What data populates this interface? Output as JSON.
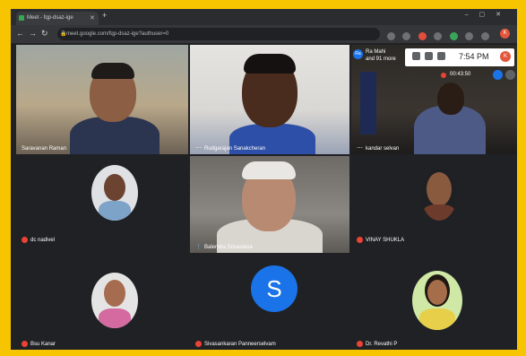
{
  "browser": {
    "tab_title": "Meet - fqp-dsaz-ige",
    "url": "meet.google.com/fqp-dsaz-ige?authuser=0",
    "profile_initial": "K"
  },
  "meeting": {
    "participants_label_line1": "Ra Mahi",
    "participants_label_line2": "and 91 more",
    "clock": "7:54 PM",
    "user_initial": "K",
    "elapsed": "00:43:50"
  },
  "tiles": [
    {
      "name": "Saravanan Raman"
    },
    {
      "name": "Rudgarajan Sanakcheran"
    },
    {
      "name": "kandar selvan"
    },
    {
      "name": "dc nadivel"
    },
    {
      "name": "Balendra Srivastava"
    },
    {
      "name": "VINAY SHUKLA"
    },
    {
      "name": "Bsu Kanar"
    },
    {
      "name": "Sivasankaran Panneerselvam",
      "avatar_letter": "S"
    },
    {
      "name": "Dr. Revathi P"
    }
  ],
  "colors": {
    "frame": "#f7c500",
    "meet_bg": "#202124",
    "avatar_blue": "#1a73e8",
    "mic_off": "#ea4335"
  }
}
